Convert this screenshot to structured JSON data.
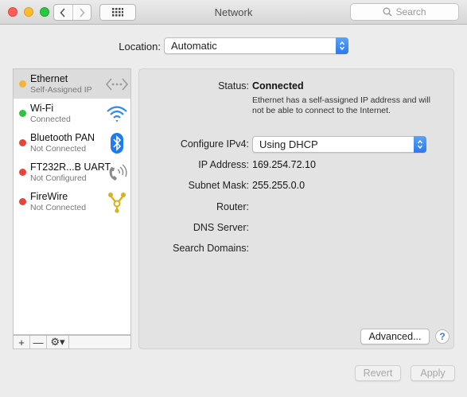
{
  "window": {
    "title": "Network"
  },
  "search": {
    "placeholder": "Search"
  },
  "location": {
    "label": "Location:",
    "value": "Automatic"
  },
  "services": [
    {
      "name": "Ethernet",
      "status": "Self-Assigned IP",
      "status_color": "#f5b437",
      "icon": "ethernet-icon",
      "selected": true
    },
    {
      "name": "Wi-Fi",
      "status": "Connected",
      "status_color": "#2fc240",
      "icon": "wifi-icon",
      "selected": false
    },
    {
      "name": "Bluetooth PAN",
      "status": "Not Connected",
      "status_color": "#e9443a",
      "icon": "bluetooth-icon",
      "selected": false
    },
    {
      "name": "FT232R...B UART",
      "status": "Not Configured",
      "status_color": "#e9443a",
      "icon": "phone-modem-icon",
      "selected": false
    },
    {
      "name": "FireWire",
      "status": "Not Connected",
      "status_color": "#e9443a",
      "icon": "firewire-icon",
      "selected": false
    }
  ],
  "list_controls": {
    "add": "+",
    "remove": "—",
    "gear": "⚙▾"
  },
  "detail": {
    "status_label": "Status:",
    "status_value": "Connected",
    "status_note": "Ethernet has a self-assigned IP address and will not be able to connect to the Internet.",
    "configure_label": "Configure IPv4:",
    "configure_value": "Using DHCP",
    "ip_label": "IP Address:",
    "ip_value": "169.254.72.10",
    "subnet_label": "Subnet Mask:",
    "subnet_value": "255.255.0.0",
    "router_label": "Router:",
    "router_value": "",
    "dns_label": "DNS Server:",
    "dns_value": "",
    "search_domains_label": "Search Domains:",
    "search_domains_value": "",
    "advanced_label": "Advanced...",
    "help_label": "?"
  },
  "footer": {
    "revert_label": "Revert",
    "apply_label": "Apply"
  },
  "colors": {
    "accent": "#2a79ee",
    "panel": "#e3e3e3"
  }
}
